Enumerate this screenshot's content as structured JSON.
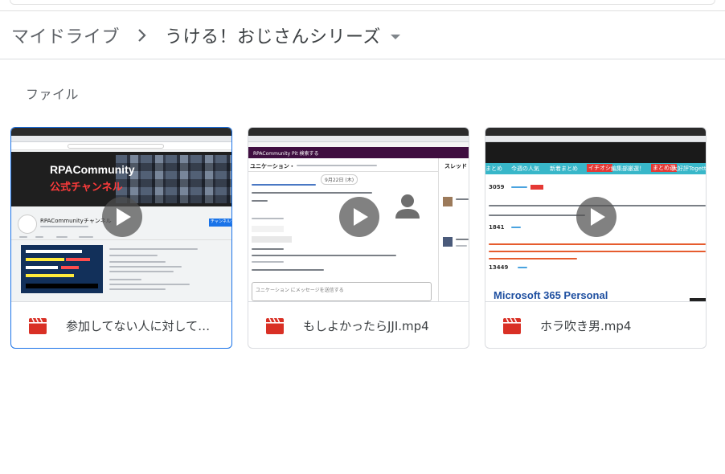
{
  "breadcrumb": {
    "root": "マイドライブ",
    "current": "うける！おじさんシリーズ"
  },
  "section_label": "ファイル",
  "colors": {
    "accent": "#1a73e8",
    "video_icon": "#d93025",
    "text_primary": "#3c4043",
    "text_secondary": "#5f6368"
  },
  "files": [
    {
      "name": "参加してない人に対して…",
      "type": "video/mp4",
      "icon": "video-file-icon",
      "selected": true,
      "thumbnail": {
        "banner_line1": "RPACommunity",
        "banner_line2": "公式チャンネル",
        "channel_name": "RPACommunityチャンネル",
        "subscribe_label": "チャンネル登録"
      }
    },
    {
      "name": "もしよかったらJJI.mp4",
      "type": "video/mp4",
      "icon": "video-file-icon",
      "selected": false,
      "thumbnail": {
        "workspace_title": "RPACommunity Pit 検索する",
        "channel_title": "ユニケーション・",
        "thread_label": "スレッド",
        "date_chip": "9月22日 (木)",
        "composer_placeholder": "ユニケーション にメッセージを送信する"
      }
    },
    {
      "name": "ホラ吹き男.mp4",
      "type": "video/mp4",
      "icon": "video-file-icon",
      "selected": false,
      "thumbnail": {
        "nav_items": [
          "まとめ",
          "今週の人気",
          "新着まとめ",
          "イチオシ",
          "編集部厳選！",
          "まとめ選",
          "大好評Togetter Clip"
        ],
        "count1": "3059",
        "count2": "1841",
        "count3": "13449",
        "headline": "Microsoft 365 Personal"
      }
    }
  ]
}
